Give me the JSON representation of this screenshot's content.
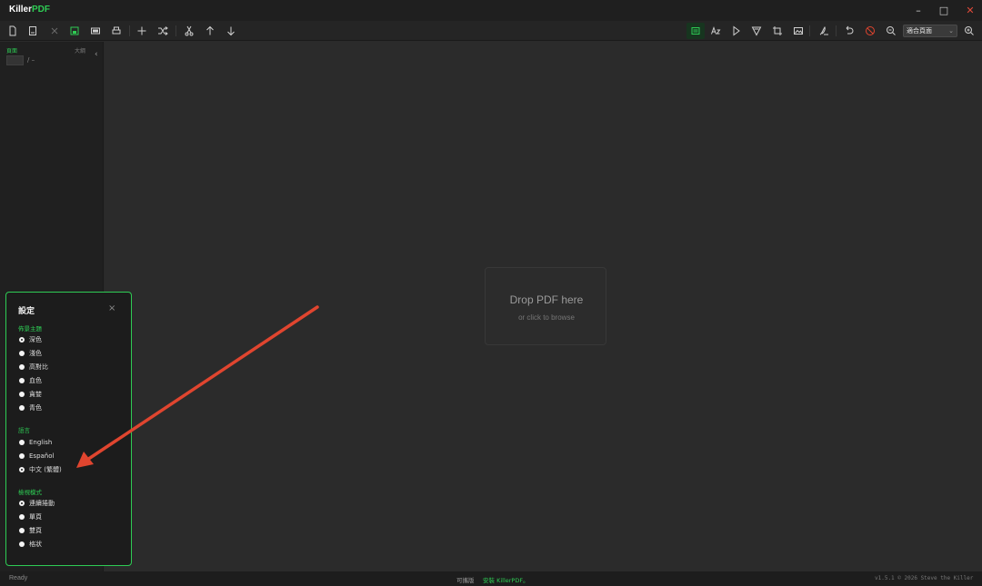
{
  "app": {
    "title_main": "Killer",
    "title_accent": "PDF"
  },
  "window": {
    "minimize_glyph": "–",
    "maximize_glyph": "□",
    "close_glyph": "✕"
  },
  "toolbar": {
    "zoom_select_value": "適合頁面",
    "icons": [
      "new-file-icon",
      "open-icon",
      "close-doc-icon",
      "save-icon",
      "present-icon",
      "print-icon",
      "add-icon",
      "shuffle-icon",
      "cut-icon",
      "move-up-icon",
      "move-down-icon",
      "select-text-icon",
      "annotate-text-icon",
      "highlight-icon",
      "markup-icon",
      "crop-icon",
      "image-icon",
      "sign-icon",
      "undo-icon",
      "redact-icon",
      "zoom-out-icon",
      "zoom-in-icon"
    ]
  },
  "sidebar": {
    "tab_pages": "頁面",
    "tab_outline": "大綱",
    "collapse_glyph": "‹",
    "page_input_value": "",
    "page_separator": "/ –"
  },
  "main": {
    "drop_title": "Drop PDF here",
    "drop_subtitle": "or click to browse"
  },
  "status": {
    "ready": "Ready",
    "trial": "可攜版",
    "install": "安裝 KillerPDF。",
    "version": "v1.5.1  © 2026  Steve the Killer"
  },
  "settings": {
    "title": "設定",
    "close_glyph": "×",
    "theme_label": "佈景主題",
    "themes": [
      {
        "label": "深色",
        "selected": true
      },
      {
        "label": "淺色",
        "selected": false
      },
      {
        "label": "高對比",
        "selected": false
      },
      {
        "label": "血色",
        "selected": false
      },
      {
        "label": "貪婪",
        "selected": false
      },
      {
        "label": "青色",
        "selected": false
      }
    ],
    "language_label": "語言",
    "languages": [
      {
        "label": "English",
        "selected": false
      },
      {
        "label": "Español",
        "selected": false
      },
      {
        "label": "中文 (繁體)",
        "selected": true
      }
    ],
    "view_label": "檢視模式",
    "views": [
      {
        "label": "連續捲動",
        "selected": true
      },
      {
        "label": "單頁",
        "selected": false
      },
      {
        "label": "雙頁",
        "selected": false
      },
      {
        "label": "格狀",
        "selected": false
      }
    ]
  },
  "colors": {
    "accent": "#2ecc54",
    "arrow": "#e0452f",
    "background": "#2b2b2b"
  }
}
